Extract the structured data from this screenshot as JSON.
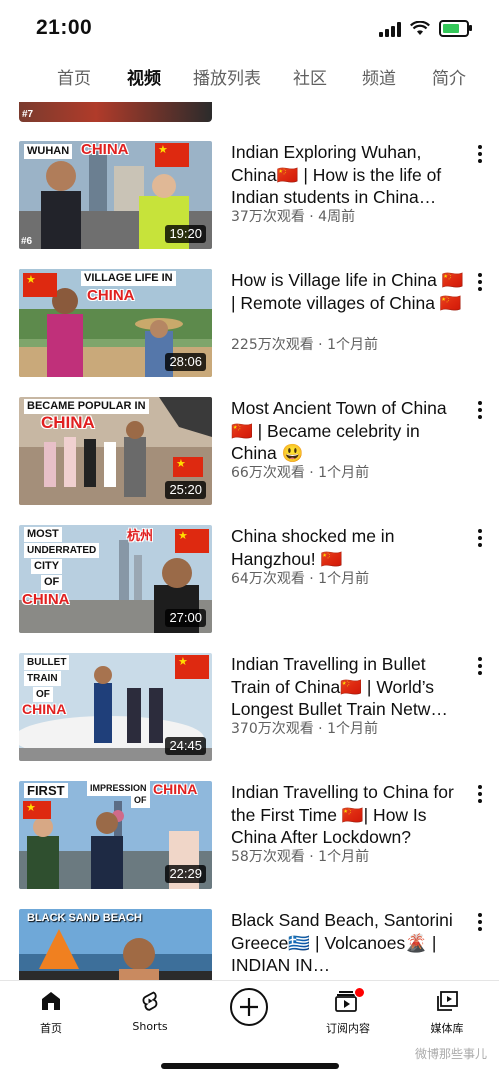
{
  "status": {
    "time": "21:00"
  },
  "tabs": [
    {
      "label": "首页"
    },
    {
      "label": "视频"
    },
    {
      "label": "播放列表"
    },
    {
      "label": "社区"
    },
    {
      "label": "频道"
    },
    {
      "label": "简介"
    }
  ],
  "active_tab": "视频",
  "partial_video": {
    "rank": "#7"
  },
  "videos": [
    {
      "title": "Indian Exploring Wuhan, China🇨🇳 | How is the life of Indian students in China…",
      "meta": "37万次观看 · 4周前",
      "duration": "19:20",
      "thumb_text": [
        "WUHAN",
        "CHINA"
      ],
      "rank": "#6"
    },
    {
      "title": "How is Village life in China 🇨🇳 | Remote villages of China 🇨🇳",
      "meta": "225万次观看 · 1个月前",
      "duration": "28:06",
      "thumb_text": [
        "VILLAGE LIFE IN",
        "CHINA"
      ]
    },
    {
      "title": "Most Ancient Town of China 🇨🇳 | Became celebrity in China 😃",
      "meta": "66万次观看 · 1个月前",
      "duration": "25:20",
      "thumb_text": [
        "BECAME POPULAR IN",
        "CHINA"
      ]
    },
    {
      "title": "China shocked me in Hangzhou! 🇨🇳",
      "meta": "64万次观看 · 1个月前",
      "duration": "27:00",
      "thumb_text": [
        "MOST",
        "UNDERRATED",
        "CITY",
        "OF",
        "CHINA",
        "杭州"
      ]
    },
    {
      "title": "Indian Travelling in Bullet Train of China🇨🇳 | World’s Longest Bullet Train Netw…",
      "meta": "370万次观看 · 1个月前",
      "duration": "24:45",
      "thumb_text": [
        "BULLET",
        "TRAIN",
        "OF",
        "CHINA"
      ]
    },
    {
      "title": "Indian Travelling to China for the First Time 🇨🇳| How Is China After Lockdown?",
      "meta": "58万次观看 · 1个月前",
      "duration": "22:29",
      "thumb_text": [
        "FIRST",
        "IMPRESSION",
        "OF",
        "CHINA"
      ]
    },
    {
      "title": "Black Sand Beach, Santorini Greece🇬🇷 | Volcanoes🌋 | INDIAN IN…",
      "meta": "",
      "duration": "",
      "thumb_text": [
        "BLACK SAND BEACH"
      ]
    }
  ],
  "nav": {
    "home": "首页",
    "shorts": "Shorts",
    "subscriptions": "订阅内容",
    "library": "媒体库"
  },
  "watermark": "微博那些事儿",
  "colors": {
    "red": "#de2910",
    "star": "#ffde00",
    "badge": "#ff0000"
  }
}
